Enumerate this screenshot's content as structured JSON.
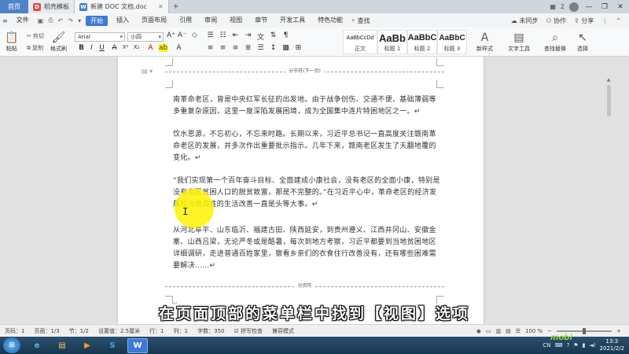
{
  "titlebar": {
    "home_tab": "首页",
    "tabs": [
      {
        "label": "稻壳模板",
        "icon": "daoke-icon",
        "color": "#e64c3c"
      },
      {
        "label": "新建 DOC 文档.doc",
        "icon": "wps-writer-icon",
        "color": "#3d7ad6"
      }
    ],
    "add_tab": "+",
    "right_badge": "2"
  },
  "menubar": {
    "file": "文件",
    "items": [
      "开始",
      "插入",
      "页面布局",
      "引用",
      "审阅",
      "视图",
      "章节",
      "开发工具",
      "特色功能"
    ],
    "search": "查找",
    "right": {
      "sync": "未同步",
      "collab": "协作",
      "share": "分享"
    }
  },
  "ribbon": {
    "paste": "粘贴",
    "cut": "剪切",
    "copy": "复制",
    "format_painter": "格式刷",
    "font_name": "Arial",
    "font_size": "小四",
    "styles": [
      {
        "sample": "AaBbCcDd",
        "name": "正文"
      },
      {
        "sample": "AaBb",
        "name": "标题 1"
      },
      {
        "sample": "AaBbC",
        "name": "标题 2"
      },
      {
        "sample": "AaBbC",
        "name": "标题 3"
      }
    ],
    "new_style": "新样式",
    "text_tools": "文字工具",
    "find_replace": "查找替换",
    "select": "选择"
  },
  "document": {
    "section_break_top": "分节符(下一页)",
    "page_break": "分页符",
    "paragraphs": [
      "南革命老区，曾是中央红军长征的出发地。由于战争创伤、交通不便、基础薄弱等多重复杂原因，这里一度深陷发展困境，成为全国集中连片特困地区之一。↵",
      "饮水思源，不忘初心，不忘来时路。长期以来，习近平总书记一直高度关注赣南革命老区的发展，并多次作出重要批示指示。几年下来，赣南老区发生了天翻地覆的变化。↵",
      "“我们实现第一个百年奋斗目标、全面建成小康社会，没有老区的全面小康，特别是没有老区贫困人口的脱贫致富，那是不完整的。”在习近平心中，革命老区的经济发展和当地百姓的生活改善一直是头等大事。↵",
      "从河北阜平、山东临沂、福建古田、陕西延安，到贵州遵义、江西井冈山、安徽金寨、山西吕梁，无论严冬或是酷暑，每次到地方考察，习近平都要到当地贫困地区详细调研，走进普通百姓家里，察看乡亲们的衣食住行改善没有，还有哪些困难需要解决……↵"
    ]
  },
  "subtitle": "在页面顶部的菜单栏中找到【视图】选项",
  "statusbar": {
    "page": "页码：1",
    "pages": "页面：1/3",
    "section": "节：1/2",
    "position": "设置值：2.5厘米",
    "row": "行：1",
    "col": "列：1",
    "words": "字数：350",
    "spell": "拼写检查",
    "compat": "兼容模式",
    "zoom": "100 %",
    "zoom_level": 0.5
  },
  "taskbar": {
    "apps": [
      {
        "name": "ie-icon",
        "glyph": "e",
        "color": "#3a9be0"
      },
      {
        "name": "folder-icon",
        "glyph": "▤",
        "color": "#e8b64a"
      },
      {
        "name": "media-icon",
        "glyph": "▶",
        "color": "#f08a1c"
      },
      {
        "name": "sogou-icon",
        "glyph": "S",
        "color": "#2d8ee8"
      },
      {
        "name": "wps-icon",
        "glyph": "W",
        "color": "#3d7ad6"
      }
    ],
    "ime": "CN",
    "time": "13:3",
    "date": "2021/2/2",
    "watermark": "mobi"
  }
}
